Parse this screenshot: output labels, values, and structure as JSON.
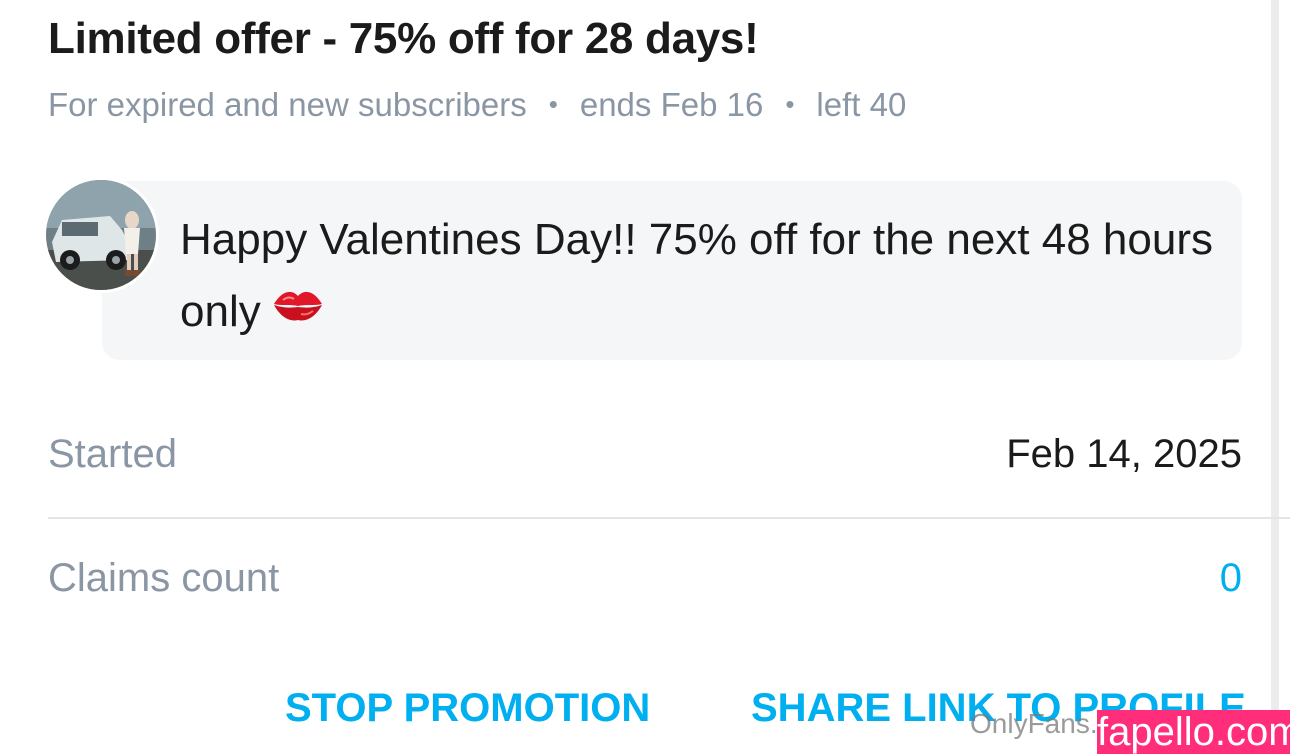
{
  "offer": {
    "title": "Limited offer - 75% off for 28 days!",
    "audience": "For expired and new subscribers",
    "ends": "ends Feb 16",
    "left": "left 40",
    "separator": "•"
  },
  "message": {
    "text": "Happy Valentines Day!! 75% off for the next 48 hours only",
    "emoji_icon": "kiss-mark-icon"
  },
  "details": {
    "started_label": "Started",
    "started_value": "Feb 14, 2025",
    "claims_label": "Claims count",
    "claims_value": "0"
  },
  "actions": {
    "stop_label": "STOP PROMOTION",
    "share_label": "SHARE LINK TO PROFILE"
  },
  "watermarks": {
    "onlyfans": "OnlyFans.",
    "fapello": "fapello.com"
  },
  "colors": {
    "accent": "#00aff0",
    "muted_text": "#8a96a3",
    "primary_text": "#1b1b1b",
    "message_bg": "#f4f6f7",
    "badge_bg": "#ff2d7a"
  }
}
